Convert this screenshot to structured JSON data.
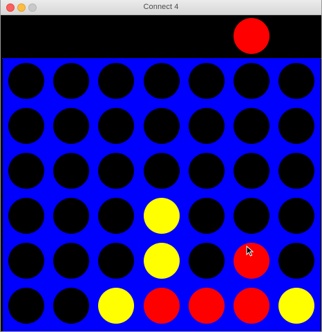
{
  "window": {
    "title": "Connect 4"
  },
  "hover_piece": {
    "column": 6,
    "color": "red"
  },
  "colors": {
    "board": "#0000ff",
    "empty": "#000000",
    "red": "#ff0000",
    "yellow": "#ffff00"
  },
  "board": {
    "rows": 6,
    "columns": 7,
    "cells": [
      [
        "empty",
        "empty",
        "empty",
        "empty",
        "empty",
        "empty",
        "empty"
      ],
      [
        "empty",
        "empty",
        "empty",
        "empty",
        "empty",
        "empty",
        "empty"
      ],
      [
        "empty",
        "empty",
        "empty",
        "empty",
        "empty",
        "empty",
        "empty"
      ],
      [
        "empty",
        "empty",
        "empty",
        "yellow",
        "empty",
        "empty",
        "empty"
      ],
      [
        "empty",
        "empty",
        "empty",
        "yellow",
        "empty",
        "red",
        "empty"
      ],
      [
        "empty",
        "empty",
        "yellow",
        "red",
        "red",
        "red",
        "yellow"
      ]
    ]
  }
}
